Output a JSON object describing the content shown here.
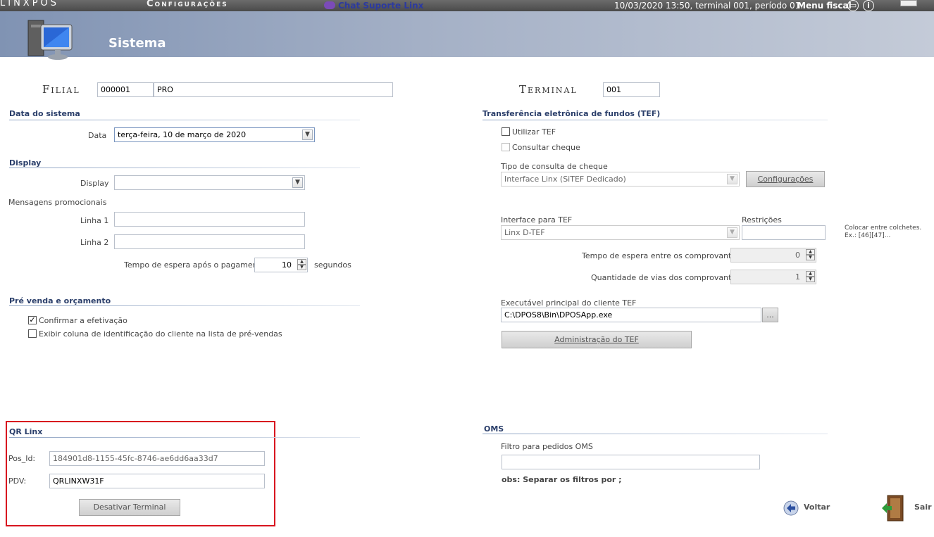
{
  "topbar": {
    "brand": "LINXPOS",
    "section": "Configurações",
    "chat": "Chat Suporte Linx",
    "status": "10/03/2020 13:50, terminal 001, período 01.",
    "menu": "Menu fiscal"
  },
  "header": {
    "title": "Sistema"
  },
  "filial": {
    "label": "Filial",
    "code": "000001",
    "name": "PRO"
  },
  "terminal": {
    "label": "Terminal",
    "value": "001"
  },
  "data_sistema": {
    "heading": "Data do sistema",
    "label": "Data",
    "value": "terça-feira, 10 de março de 2020"
  },
  "display": {
    "heading": "Display",
    "label": "Display",
    "value": "",
    "msg_heading": "Mensagens promocionais",
    "linha1_label": "Linha 1",
    "linha1": "",
    "linha2_label": "Linha 2",
    "linha2": "",
    "tempo_label": "Tempo de espera após o pagamento",
    "tempo_value": "10",
    "tempo_unit": "segundos"
  },
  "prevenda": {
    "heading": "Pré venda e orçamento",
    "confirmar": {
      "label": "Confirmar a efetivação",
      "checked": true
    },
    "exibir": {
      "label": "Exibir coluna de identificação do cliente na lista de pré-vendas",
      "checked": false
    }
  },
  "qr": {
    "heading": "QR Linx",
    "pos_label": "Pos_Id:",
    "pos_value": "184901d8-1155-45fc-8746-ae6dd6aa33d7",
    "pdv_label": "PDV:",
    "pdv_value": "QRLINXW31F",
    "button": "Desativar Terminal"
  },
  "tef": {
    "heading": "Transferência eletrônica de fundos (TEF)",
    "utilizar": {
      "label": "Utilizar TEF",
      "checked": false
    },
    "consultar": {
      "label": "Consultar cheque",
      "checked": false
    },
    "tipo_label": "Tipo de consulta de cheque",
    "tipo_value": "Interface Linx (SiTEF Dedicado)",
    "config_button": "Configurações",
    "interface_label": "Interface para TEF",
    "interface_value": "Linx D-TEF",
    "restricoes_label": "Restrições",
    "restricoes_value": "",
    "colchetes_note": "Colocar entre colchetes.",
    "colchetes_ex": "Ex.: [46][47]...",
    "tempo_label": "Tempo de espera entre os comprovantes",
    "tempo_value": "0",
    "vias_label": "Quantidade de vias dos comprovantes",
    "vias_value": "1",
    "exec_label": "Executável principal do cliente TEF",
    "exec_value": "C:\\DPOS8\\Bin\\DPOSApp.exe",
    "browse": "...",
    "admin_button": "Administração do TEF"
  },
  "oms": {
    "heading": "OMS",
    "filtro_label": "Filtro para pedidos OMS",
    "filtro_value": "",
    "obs": "obs: Separar os filtros por ;"
  },
  "footer": {
    "voltar": "Voltar",
    "sair": "Sair"
  },
  "colors": {
    "highlight_border": "#d8151f",
    "section_heading": "#2a3e6a",
    "header_gradient_start": "#8093b3"
  }
}
